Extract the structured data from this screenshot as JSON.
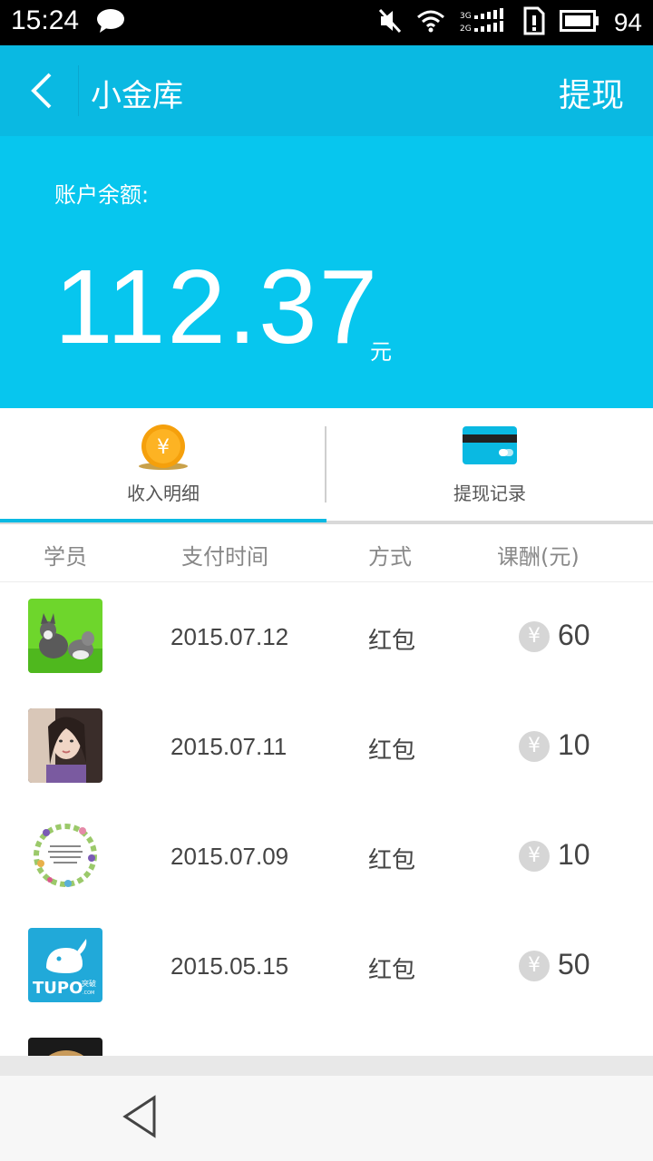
{
  "status": {
    "time": "15:24",
    "battery": "94",
    "network": "3G 2G"
  },
  "header": {
    "title": "小金库",
    "action_label": "提现"
  },
  "balance": {
    "label": "账户余额:",
    "amount": "112.37",
    "unit": "元"
  },
  "tabs": [
    {
      "label": "收入明细",
      "active": true,
      "icon": "coin-icon"
    },
    {
      "label": "提现记录",
      "active": false,
      "icon": "card-icon"
    }
  ],
  "columns": {
    "student": "学员",
    "time": "支付时间",
    "method": "方式",
    "fee": "课酬(元)"
  },
  "rows": [
    {
      "avatar": "dog-avatar",
      "date": "2015.07.12",
      "method": "红包",
      "currency": "¥",
      "amount": "60"
    },
    {
      "avatar": "woman-avatar",
      "date": "2015.07.11",
      "method": "红包",
      "currency": "¥",
      "amount": "10"
    },
    {
      "avatar": "wreath-avatar",
      "date": "2015.07.09",
      "method": "红包",
      "currency": "¥",
      "amount": "10"
    },
    {
      "avatar": "tupo-logo-avatar",
      "date": "2015.05.15",
      "method": "红包",
      "currency": "¥",
      "amount": "50",
      "logo_text": "TUPO",
      "logo_sub": "突破",
      "logo_domain": ".COM"
    }
  ],
  "colors": {
    "app_bar": "#0ab9e2",
    "balance_panel": "#07c6ee",
    "tab_indicator": "#0ab9e2",
    "coin": "#f5a00c"
  }
}
